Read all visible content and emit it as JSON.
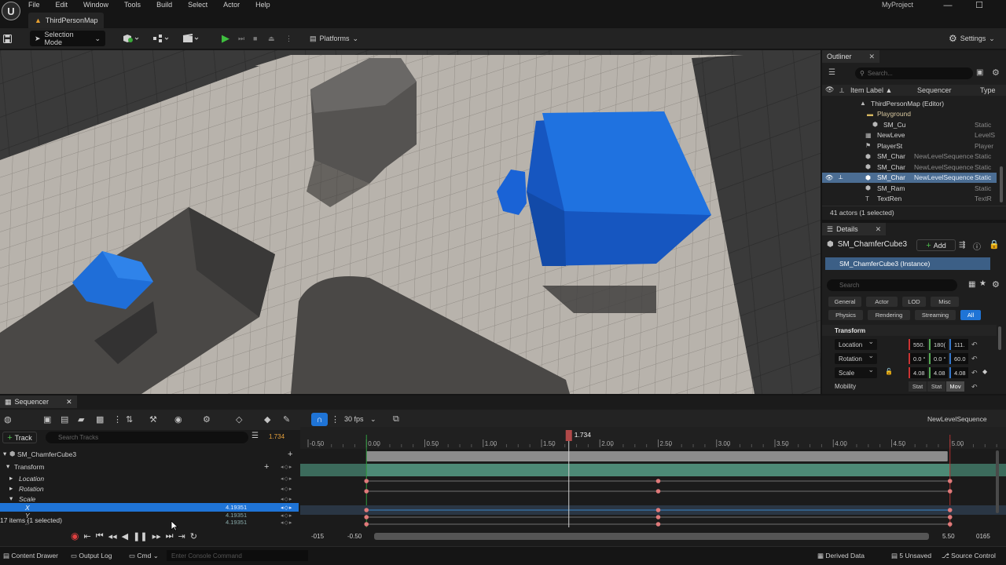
{
  "menu": [
    "File",
    "Edit",
    "Window",
    "Tools",
    "Build",
    "Select",
    "Actor",
    "Help"
  ],
  "map_tab": "ThirdPersonMap",
  "project_name": "MyProject",
  "window_controls": [
    "—",
    "☐",
    "✕"
  ],
  "toolbar": {
    "selection_mode": "Selection Mode",
    "platforms": "Platforms",
    "settings": "Settings"
  },
  "outliner": {
    "tab": "Outliner",
    "search_placeholder": "Search...",
    "columns": {
      "label": "Item Label ▲",
      "sequencer": "Sequencer",
      "type": "Type"
    },
    "rows": [
      {
        "label": "ThirdPersonMap (Editor)",
        "sequencer": "",
        "type": ""
      },
      {
        "label": "Playground",
        "sequencer": "",
        "type": ""
      },
      {
        "label": "SM_Cu",
        "sequencer": "",
        "type": "Static"
      },
      {
        "label": "NewLeve",
        "sequencer": "",
        "type": "LevelS"
      },
      {
        "label": "PlayerSt",
        "sequencer": "",
        "type": "Player"
      },
      {
        "label": "SM_Char",
        "sequencer": "NewLevelSequence",
        "type": "Static"
      },
      {
        "label": "SM_Char",
        "sequencer": "NewLevelSequence",
        "type": "Static"
      },
      {
        "label": "SM_Char",
        "sequencer": "NewLevelSequence",
        "type": "Static"
      },
      {
        "label": "SM_Ram",
        "sequencer": "",
        "type": "Static"
      },
      {
        "label": "TextRen",
        "sequencer": "",
        "type": "TextR"
      }
    ],
    "status": "41 actors (1 selected)"
  },
  "details": {
    "tab": "Details",
    "actor_name": "SM_ChamferCube3",
    "add_label": "Add",
    "instance": "SM_ChamferCube3 (Instance)",
    "search_placeholder": "Search",
    "filters_row1": [
      "General",
      "Actor",
      "LOD",
      "Misc"
    ],
    "filters_row2": [
      "Physics",
      "Rendering",
      "Streaming",
      "All"
    ],
    "section": "Transform",
    "location": {
      "label": "Location",
      "x": "550.",
      "y": "180(",
      "z": "111."
    },
    "rotation": {
      "label": "Rotation",
      "x": "0.0 °",
      "y": "0.0 °",
      "z": "60.0"
    },
    "scale": {
      "label": "Scale",
      "x": "4.08",
      "y": "4.08",
      "z": "4.08"
    },
    "mobility": {
      "label": "Mobility",
      "options": [
        "Stat",
        "Stat",
        "Mov"
      ]
    }
  },
  "sequencer": {
    "tab": "Sequencer",
    "fps": "30 fps",
    "sequence_name": "NewLevelSequence",
    "track_button": "Track",
    "search_placeholder": "Search Tracks",
    "current_time_small": "1.734",
    "current_time": "1.734",
    "tracks": [
      {
        "label": "SM_ChamferCube3",
        "value": "",
        "indent": 1
      },
      {
        "label": "Transform",
        "value": "",
        "indent": 2
      },
      {
        "label": "Location",
        "value": "",
        "indent": 3
      },
      {
        "label": "Rotation",
        "value": "",
        "indent": 3
      },
      {
        "label": "Scale",
        "value": "",
        "indent": 3
      },
      {
        "label": "X",
        "value": "4.19351",
        "indent": 4
      },
      {
        "label": "Y",
        "value": "4.19351",
        "indent": 4
      },
      {
        "label": "Z",
        "value": "4.19351",
        "indent": 4
      }
    ],
    "items_count": "17 items (1 selected)",
    "ruler": [
      "-0.50",
      "0.00",
      "0.50",
      "1.00",
      "1.50",
      "2.00",
      "2.50",
      "3.00",
      "3.50",
      "4.00",
      "4.50",
      "5.00"
    ],
    "start_field": "-015",
    "view_start": "-0.50",
    "view_end": "5.50",
    "end_field": "0165",
    "keyframe_times": [
      0.0,
      2.5,
      5.0
    ]
  },
  "statusbar": {
    "content_drawer": "Content Drawer",
    "output_log": "Output Log",
    "cmd": "Cmd",
    "console_placeholder": "Enter Console Command",
    "derived_data": "Derived Data",
    "unsaved": "5 Unsaved",
    "source_control": "Source Control"
  },
  "colors": {
    "accent": "#1f74d6",
    "selection": "#4b6d93",
    "playhead": "#b04848",
    "key": "#e07a7a",
    "cube": "#1a63d6",
    "section": "#4d8a76"
  }
}
